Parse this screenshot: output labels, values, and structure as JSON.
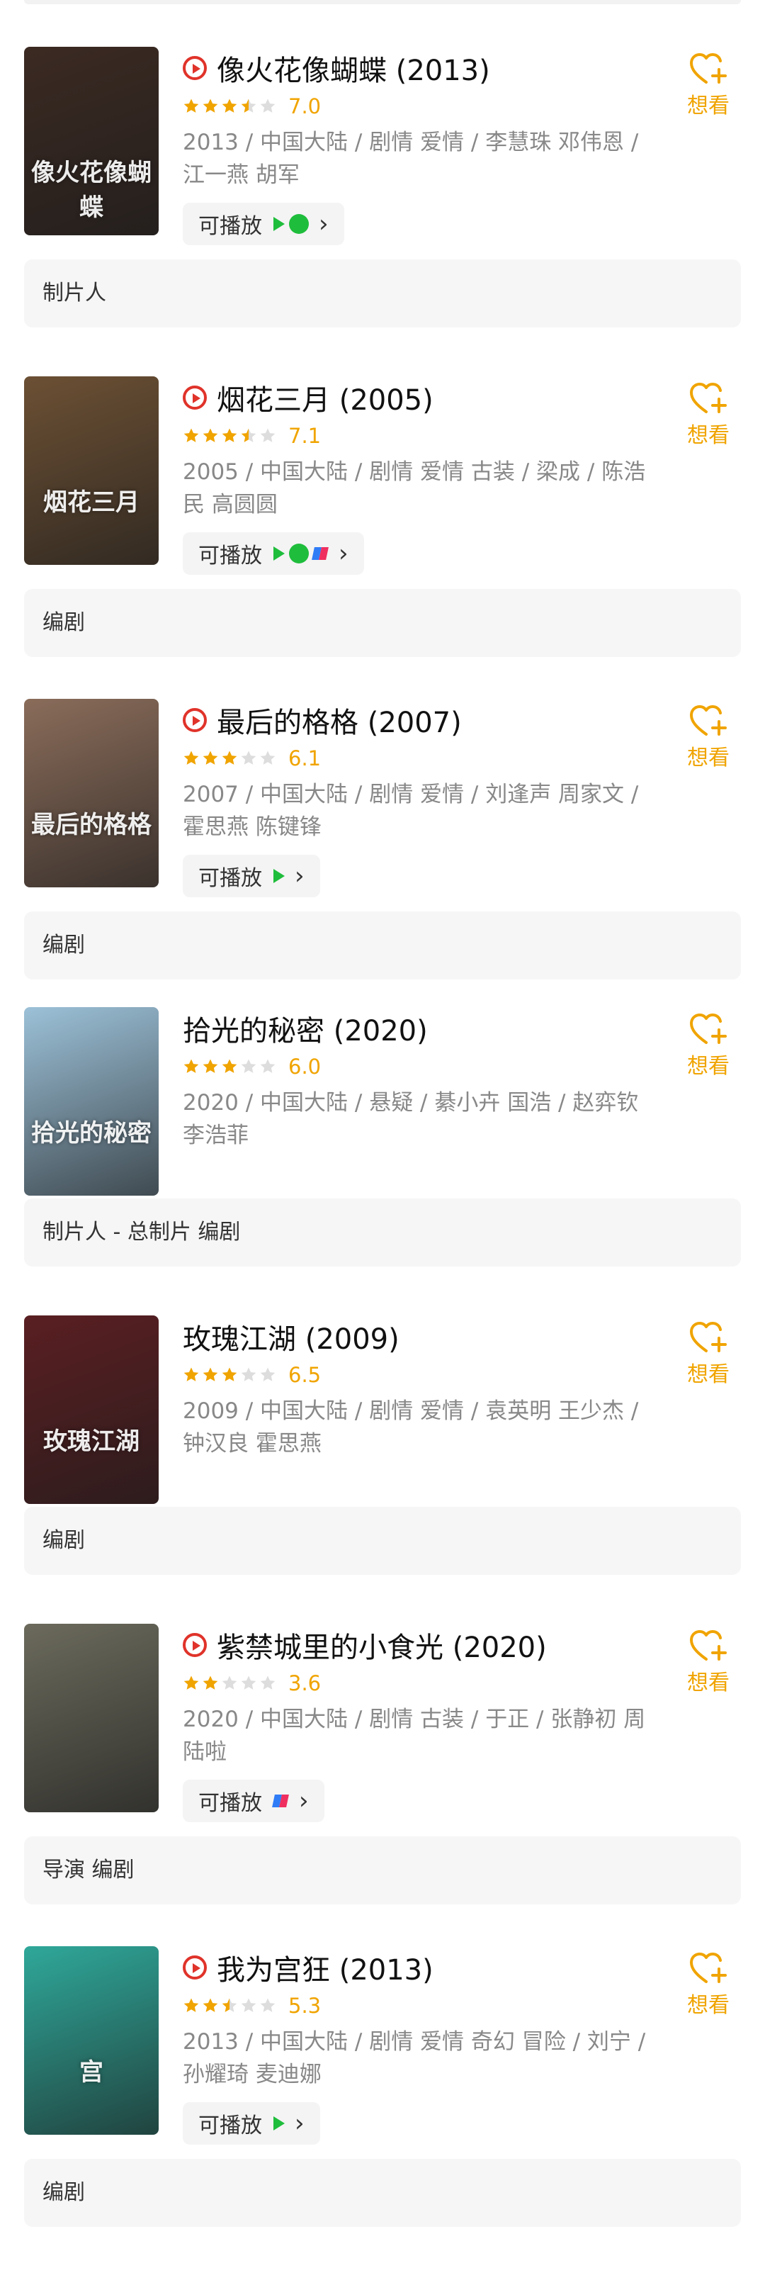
{
  "want_label": "想看",
  "play_label": "可播放",
  "items": [
    {
      "title": "像火花像蝴蝶 (2013)",
      "playable": true,
      "stars": 3.5,
      "score": "7.0",
      "meta": "2013 / 中国大陆 / 剧情 爱情 / 李慧珠 邓伟恩 / 江一燕 胡军",
      "sources": [
        "tencent",
        "iqiyi"
      ],
      "role": "制片人",
      "poster_color": "#3b2a22",
      "poster_text": "像火花像蝴蝶"
    },
    {
      "title": "烟花三月 (2005)",
      "playable": true,
      "stars": 3.5,
      "score": "7.1",
      "meta": "2005 / 中国大陆 / 剧情 爱情 古装 / 梁成 / 陈浩民 高圆圆",
      "sources": [
        "tencent",
        "iqiyi",
        "mgtv"
      ],
      "role": "编剧",
      "poster_color": "#6c5034",
      "poster_text": "烟花三月"
    },
    {
      "title": "最后的格格 (2007)",
      "playable": true,
      "stars": 3,
      "score": "6.1",
      "meta": "2007 / 中国大陆 / 剧情 爱情 / 刘逢声 周家文 / 霍思燕 陈键锋",
      "sources": [
        "tencent"
      ],
      "role": "编剧",
      "poster_color": "#8a6c5a",
      "poster_text": "最后的格格"
    },
    {
      "title": "拾光的秘密 (2020)",
      "playable": false,
      "stars": 3,
      "score": "6.0",
      "meta": "2020 / 中国大陆 / 悬疑 / 綦小卉 国浩 / 赵弈钦 李浩菲",
      "sources": [],
      "role": "制片人 - 总制片 编剧",
      "poster_color": "#9cc1d8",
      "poster_text": "拾光的秘密"
    },
    {
      "title": "玫瑰江湖 (2009)",
      "playable": false,
      "stars": 3,
      "score": "6.5",
      "meta": "2009 / 中国大陆 / 剧情 爱情 / 袁英明 王少杰 / 钟汉良 霍思燕",
      "sources": [],
      "role": "编剧",
      "poster_color": "#5a1f22",
      "poster_text": "玫瑰江湖"
    },
    {
      "title": "紫禁城里的小食光 (2020)",
      "playable": true,
      "stars": 2,
      "score": "3.6",
      "meta": "2020 / 中国大陆 / 剧情 古装 / 于正 / 张静初 周陆啦",
      "sources": [
        "mgtv"
      ],
      "role": "导演 编剧",
      "poster_color": "#6b6a5c",
      "poster_text": ""
    },
    {
      "title": "我为宫狂 (2013)",
      "playable": true,
      "stars": 2.5,
      "score": "5.3",
      "meta": "2013 / 中国大陆 / 剧情 爱情 奇幻 冒险 / 刘宁 / 孙耀琦 麦迪娜",
      "sources": [
        "tencent"
      ],
      "role": "编剧",
      "poster_color": "#2fa89a",
      "poster_text": "宫"
    }
  ],
  "colors": {
    "accent": "#f0a400",
    "play_red": "#e0332a",
    "meta_gray": "#888888",
    "role_bg": "#f6f6f6"
  }
}
